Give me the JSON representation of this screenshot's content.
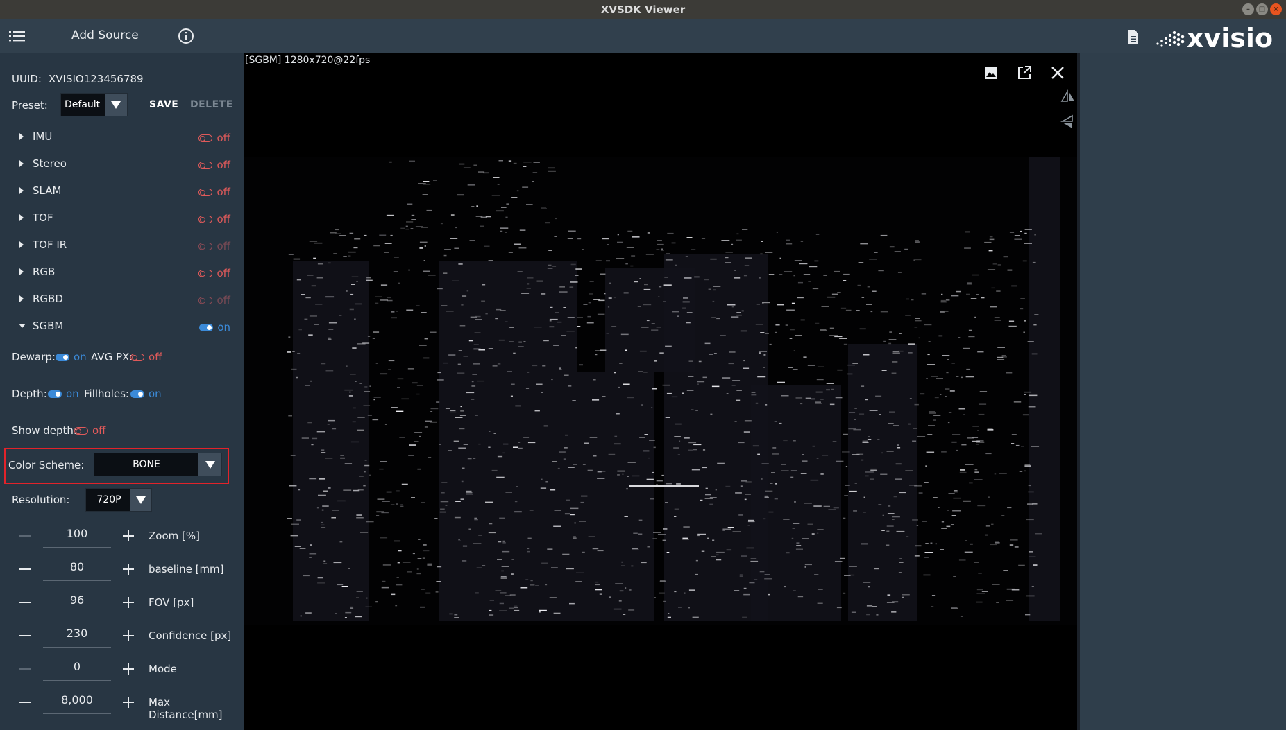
{
  "window": {
    "title": "XVSDK Viewer"
  },
  "header": {
    "menu_icon": "hamburger-list-icon",
    "add_source_label": "Add Source",
    "info_icon": "info-circle-icon",
    "document_icon": "document-icon",
    "logo_text": "xvisio"
  },
  "device": {
    "uuid_label": "UUID:",
    "uuid_value": "XVISIO123456789",
    "preset_label": "Preset:",
    "preset_value": "Default",
    "save_label": "SAVE",
    "delete_label": "DELETE"
  },
  "sensors": [
    {
      "name": "IMU",
      "state": "off",
      "enabled": true,
      "expanded": false
    },
    {
      "name": "Stereo",
      "state": "off",
      "enabled": true,
      "expanded": false
    },
    {
      "name": "SLAM",
      "state": "off",
      "enabled": true,
      "expanded": false
    },
    {
      "name": "TOF",
      "state": "off",
      "enabled": true,
      "expanded": false
    },
    {
      "name": "TOF IR",
      "state": "off",
      "enabled": false,
      "expanded": false
    },
    {
      "name": "RGB",
      "state": "off",
      "enabled": true,
      "expanded": false
    },
    {
      "name": "RGBD",
      "state": "off",
      "enabled": false,
      "expanded": false
    },
    {
      "name": "SGBM",
      "state": "on",
      "enabled": true,
      "expanded": true
    }
  ],
  "sgbm": {
    "dewarp_label": "Dewarp:",
    "dewarp_state": "on",
    "avgpx_label": "AVG PX:",
    "avgpx_state": "off",
    "depth_label": "Depth:",
    "depth_state": "on",
    "fillholes_label": "Fillholes:",
    "fillholes_state": "on",
    "showdepth_label": "Show depth:",
    "showdepth_state": "off",
    "color_scheme_label": "Color Scheme:",
    "color_scheme_value": "BONE",
    "resolution_label": "Resolution:",
    "resolution_value": "720P",
    "steppers": [
      {
        "value": "100",
        "label": "Zoom [%]",
        "minus_enabled": false
      },
      {
        "value": "80",
        "label": "baseline [mm]",
        "minus_enabled": true
      },
      {
        "value": "96",
        "label": "FOV [px]",
        "minus_enabled": true
      },
      {
        "value": "230",
        "label": "Confidence [px]",
        "minus_enabled": true
      },
      {
        "value": "0",
        "label": "Mode",
        "minus_enabled": false
      },
      {
        "value": "8,000",
        "label": "Max Distance[mm]",
        "minus_enabled": true
      }
    ]
  },
  "viewer": {
    "stream_info": "[SGBM]  1280x720@22fps",
    "toolbar_icons": [
      "image-icon",
      "open-external-icon",
      "close-icon"
    ],
    "side_icons": [
      "flip-horizontal-icon",
      "flip-vertical-icon"
    ]
  },
  "colors": {
    "panel_bg": "#283643",
    "header_bg": "#31404d",
    "toggle_on": "#3b8ad8",
    "toggle_off": "#e05a5a",
    "highlight": "#e2232a"
  }
}
